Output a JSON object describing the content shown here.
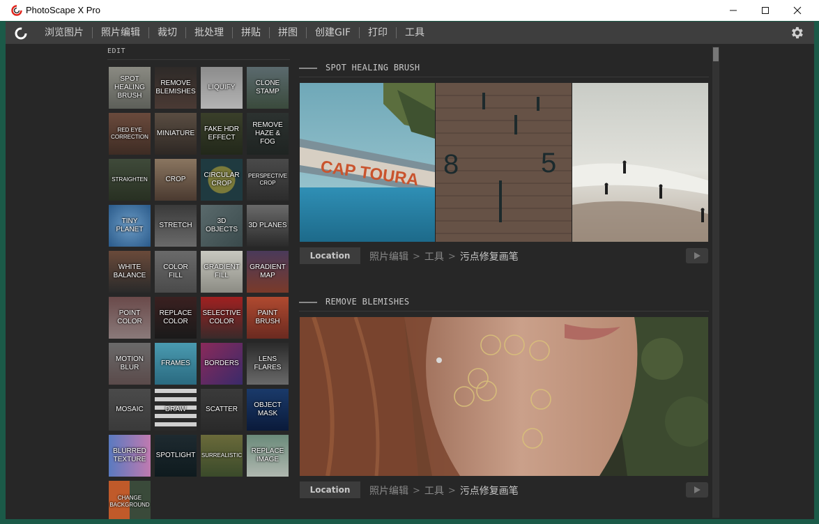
{
  "window": {
    "title": "PhotoScape X Pro",
    "minimize": "—",
    "maximize": "☐",
    "close": "✕"
  },
  "menu": {
    "items": [
      "浏览图片",
      "照片编辑",
      "裁切",
      "批处理",
      "拼贴",
      "拼图",
      "创建GIF",
      "打印",
      "工具"
    ],
    "icons": {
      "logo": "photoscape-logo-icon",
      "settings": "gear-icon"
    }
  },
  "sidebar": {
    "section_label": "EDIT",
    "tools": [
      "SPOT HEALING BRUSH",
      "REMOVE BLEMISHES",
      "LIQUIFY",
      "CLONE STAMP",
      "RED EYE CORRECTION",
      "MINIATURE",
      "FAKE HDR EFFECT",
      "REMOVE HAZE & FOG",
      "STRAIGHTEN",
      "CROP",
      "CIRCULAR CROP",
      "PERSPECTIVE CROP",
      "TINY PLANET",
      "STRETCH",
      "3D OBJECTS",
      "3D PLANES",
      "WHITE BALANCE",
      "COLOR FILL",
      "GRADIENT FILL",
      "GRADIENT MAP",
      "POINT COLOR",
      "REPLACE COLOR",
      "SELECTIVE COLOR",
      "PAINT BRUSH",
      "MOTION BLUR",
      "FRAMES",
      "BORDERS",
      "LENS FLARES",
      "MOSAIC",
      "DRAW",
      "SCATTER",
      "OBJECT MASK",
      "BLURRED TEXTURE",
      "SPOTLIGHT",
      "SURREALISTIC",
      "REPLACE IMAGE",
      "CHANGE BACKGROUND"
    ]
  },
  "sections": [
    {
      "title": "SPOT HEALING BRUSH",
      "location_label": "Location",
      "breadcrumb": [
        "照片编辑",
        "工具",
        "污点修复画笔"
      ],
      "image_text": [
        "CAP TOURA",
        "8",
        "5"
      ]
    },
    {
      "title": "REMOVE BLEMISHES",
      "location_label": "Location",
      "breadcrumb": [
        "照片编辑",
        "工具",
        "污点修复画笔"
      ]
    }
  ],
  "colors": {
    "window_bg": "#1b5a48",
    "content_bg": "#272727",
    "menubar_bg": "#3e3e3e"
  }
}
